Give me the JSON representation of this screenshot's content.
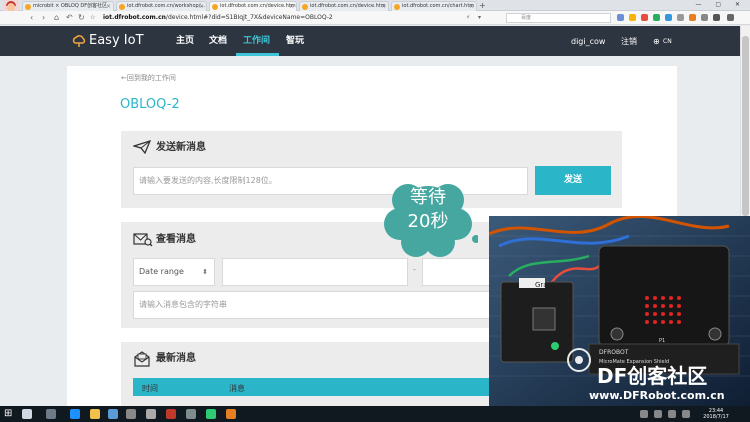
{
  "browser": {
    "tabs": [
      {
        "title": "microbit × OBLOQ DF创客社区"
      },
      {
        "title": "iot.dfrobot.com.cn/workshop/..."
      },
      {
        "title": "iot.dfrobot.com.cn/device.htm"
      },
      {
        "title": "iot.dfrobot.com.cn/device.htm"
      },
      {
        "title": "iot.dfrobot.com.cn/chart.htm"
      }
    ],
    "new_tab": "+",
    "url_domain": "iot.dfrobot.com.cn",
    "url_path": "/device.html#?did=S1BIqjt_7X&deviceName=OBLOQ-2",
    "search_placeholder": "百度",
    "window_controls": "— ▢ ✕"
  },
  "header": {
    "logo": "Easy IoT",
    "nav": [
      {
        "label": "主页",
        "active": false
      },
      {
        "label": "文档",
        "active": false
      },
      {
        "label": "工作间",
        "active": true
      },
      {
        "label": "智玩",
        "active": false
      }
    ],
    "username": "digi_cow",
    "logout": "注销",
    "language": "CN"
  },
  "page": {
    "back_link": "←回到我的工作间",
    "device_name": "OBLOQ-2",
    "send": {
      "title": "发送新消息",
      "placeholder": "请输入要发送的内容,长度限制128位。",
      "button": "发送"
    },
    "query": {
      "title": "查看消息",
      "date_range": "Date range",
      "date_sep": "-",
      "filter_placeholder": "请输入消息包含的字符串"
    },
    "latest": {
      "title": "最新消息",
      "columns": [
        "时间",
        "消息"
      ]
    }
  },
  "overlay": {
    "bubble_line1": "等待",
    "bubble_line2": "20秒",
    "watermark_brand": "DF创客社区",
    "watermark_url": "www.DFRobot.com.cn",
    "board_labels": {
      "gravity": "Gravity",
      "dfrobot": "DFROBOT",
      "shield": "MicroMate Expansion Shield",
      "pin_label": "P1"
    }
  },
  "taskbar": {
    "time": "23:44",
    "date": "2018/7/17"
  },
  "colors": {
    "accent": "#2bb5c9",
    "header_bg": "#2d3640",
    "bubble": "#45a7a0"
  }
}
